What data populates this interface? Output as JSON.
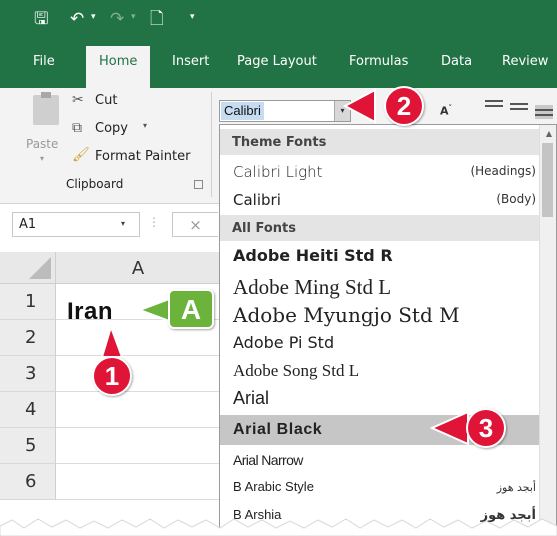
{
  "qat": {
    "save_icon": "save-icon",
    "undo_icon": "undo-icon",
    "redo_icon": "redo-icon",
    "new_icon": "new-document-icon",
    "customize_icon": "customize-qat-icon"
  },
  "tabs": [
    {
      "label": "File"
    },
    {
      "label": "Home",
      "active": true
    },
    {
      "label": "Insert"
    },
    {
      "label": "Page Layout"
    },
    {
      "label": "Formulas"
    },
    {
      "label": "Data"
    },
    {
      "label": "Review"
    }
  ],
  "clipboard": {
    "paste_label": "Paste",
    "cut_label": "Cut",
    "copy_label": "Copy",
    "format_painter_label": "Format Painter",
    "group_label": "Clipboard"
  },
  "font": {
    "current_font": "Calibri",
    "shrink_icon": "decrease-font-size-icon"
  },
  "formula_bar": {
    "name_box": "A1",
    "cancel_icon": "×"
  },
  "grid": {
    "column_header": "A",
    "row_headers": [
      "1",
      "2",
      "3",
      "4",
      "5",
      "6"
    ],
    "cell_a1": "Iran"
  },
  "font_list": {
    "theme_section": "Theme Fonts",
    "theme_fonts": [
      {
        "name": "Calibri Light",
        "tag": "(Headings)"
      },
      {
        "name": "Calibri",
        "tag": "(Body)"
      }
    ],
    "all_section": "All Fonts",
    "all_fonts": [
      {
        "name": "Adobe Heiti Std R"
      },
      {
        "name": "Adobe Ming Std L"
      },
      {
        "name": "Adobe Myungjo Std M"
      },
      {
        "name": "Adobe Pi Std"
      },
      {
        "name": "Adobe Song Std L"
      },
      {
        "name": "Arial"
      },
      {
        "name": "Arial Black",
        "highlighted": true
      },
      {
        "name": "Arial Narrow"
      },
      {
        "name": "B Arabic Style",
        "sample": "أبجد هوز"
      },
      {
        "name": "B Arshia",
        "sample": "أبجد هوز"
      }
    ]
  },
  "callouts": {
    "one": "1",
    "two": "2",
    "three": "3",
    "a": "A"
  },
  "colors": {
    "excel_green": "#217346",
    "callout_red": "#e01436",
    "callout_green": "#6bb33a",
    "highlight_gray": "#c6c6c6"
  }
}
